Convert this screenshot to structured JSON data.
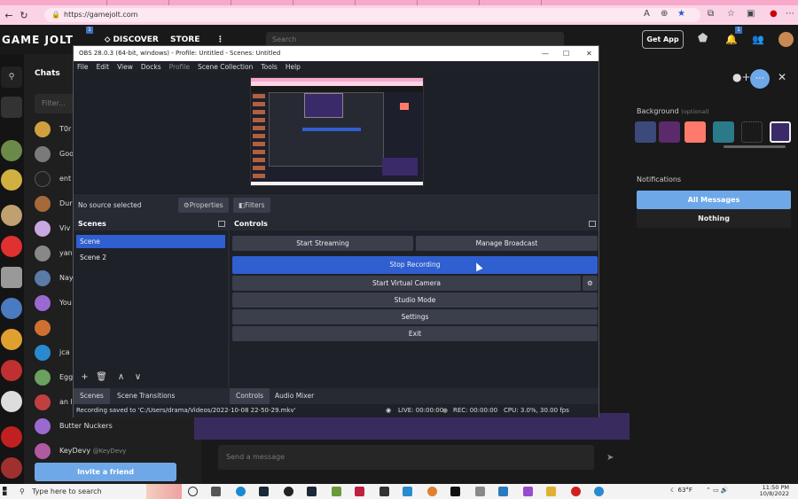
{
  "browser": {
    "url": "https://gamejolt.com"
  },
  "gamejolt": {
    "logo": "GAME JOLT",
    "nav_discover": "DISCOVER",
    "nav_store": "STORE",
    "search_placeholder": "Search",
    "get_app": "Get App",
    "badge": "1",
    "chats_title": "Chats",
    "filter_placeholder": "Filter...",
    "chat_rows": [
      {
        "name": "T0r",
        "color": "#d0a040"
      },
      {
        "name": "Goo",
        "color": "#7a7a7a"
      },
      {
        "name": "ent",
        "color": "#222222"
      },
      {
        "name": "Dur",
        "color": "#a56a3a"
      },
      {
        "name": "Viv",
        "color": "#c8a8e0"
      },
      {
        "name": "yan",
        "color": "#888888"
      },
      {
        "name": "Nay",
        "color": "#5a7aa8"
      },
      {
        "name": "You",
        "color": "#9a6ad0"
      },
      {
        "name": "jca",
        "color": "#2a8ad0"
      },
      {
        "name": "Egg",
        "color": "#6aa060"
      },
      {
        "name": "an l",
        "color": "#c04040"
      },
      {
        "name": "Butter Nuckers",
        "color": "#9a6ad0"
      },
      {
        "name": "KeyDevy",
        "color": "#b05aa0"
      }
    ],
    "keydevy_handle": "@KeyDevy",
    "invite_button": "Invite a friend",
    "background_label": "Background",
    "background_optional": "(optional)",
    "background_swatches": [
      "#3b4a7a",
      "#5a2a6a",
      "#ff7a6a",
      "#2a7a8a",
      "#1a1a1a",
      "#3a2a6a"
    ],
    "notifications_label": "Notifications",
    "all_messages": "All Messages",
    "nothing": "Nothing",
    "send_placeholder": "Send a message"
  },
  "obs": {
    "title": "OBS 28.0.3 (64-bit, windows) - Profile: Untitled - Scenes: Untitled",
    "menu": [
      "File",
      "Edit",
      "View",
      "Docks",
      "Profile",
      "Scene Collection",
      "Tools",
      "Help"
    ],
    "no_source": "No source selected",
    "properties": "Properties",
    "filters": "Filters",
    "scenes_header": "Scenes",
    "scenes": [
      "Scene",
      "Scene 2"
    ],
    "controls_header": "Controls",
    "start_streaming": "Start Streaming",
    "manage_broadcast": "Manage Broadcast",
    "stop_recording": "Stop Recording",
    "start_virtual_camera": "Start Virtual Camera",
    "studio_mode": "Studio Mode",
    "settings": "Settings",
    "exit": "Exit",
    "tab_scenes": "Scenes",
    "tab_scene_transitions": "Scene Transitions",
    "tab_controls": "Controls",
    "tab_audio_mixer": "Audio Mixer",
    "status_saved": "Recording saved to 'C:/Users/drama/Videos/2022-10-08 22-50-29.mkv'",
    "status_live": "LIVE: 00:00:00",
    "status_rec": "REC: 00:00:00",
    "status_cpu": "CPU: 3.0%, 30.00 fps",
    "accent": "#2f5fd0"
  },
  "taskbar": {
    "search_placeholder": "Type here to search",
    "weather": "63°F",
    "time": "11:50 PM",
    "date": "10/8/2022"
  }
}
